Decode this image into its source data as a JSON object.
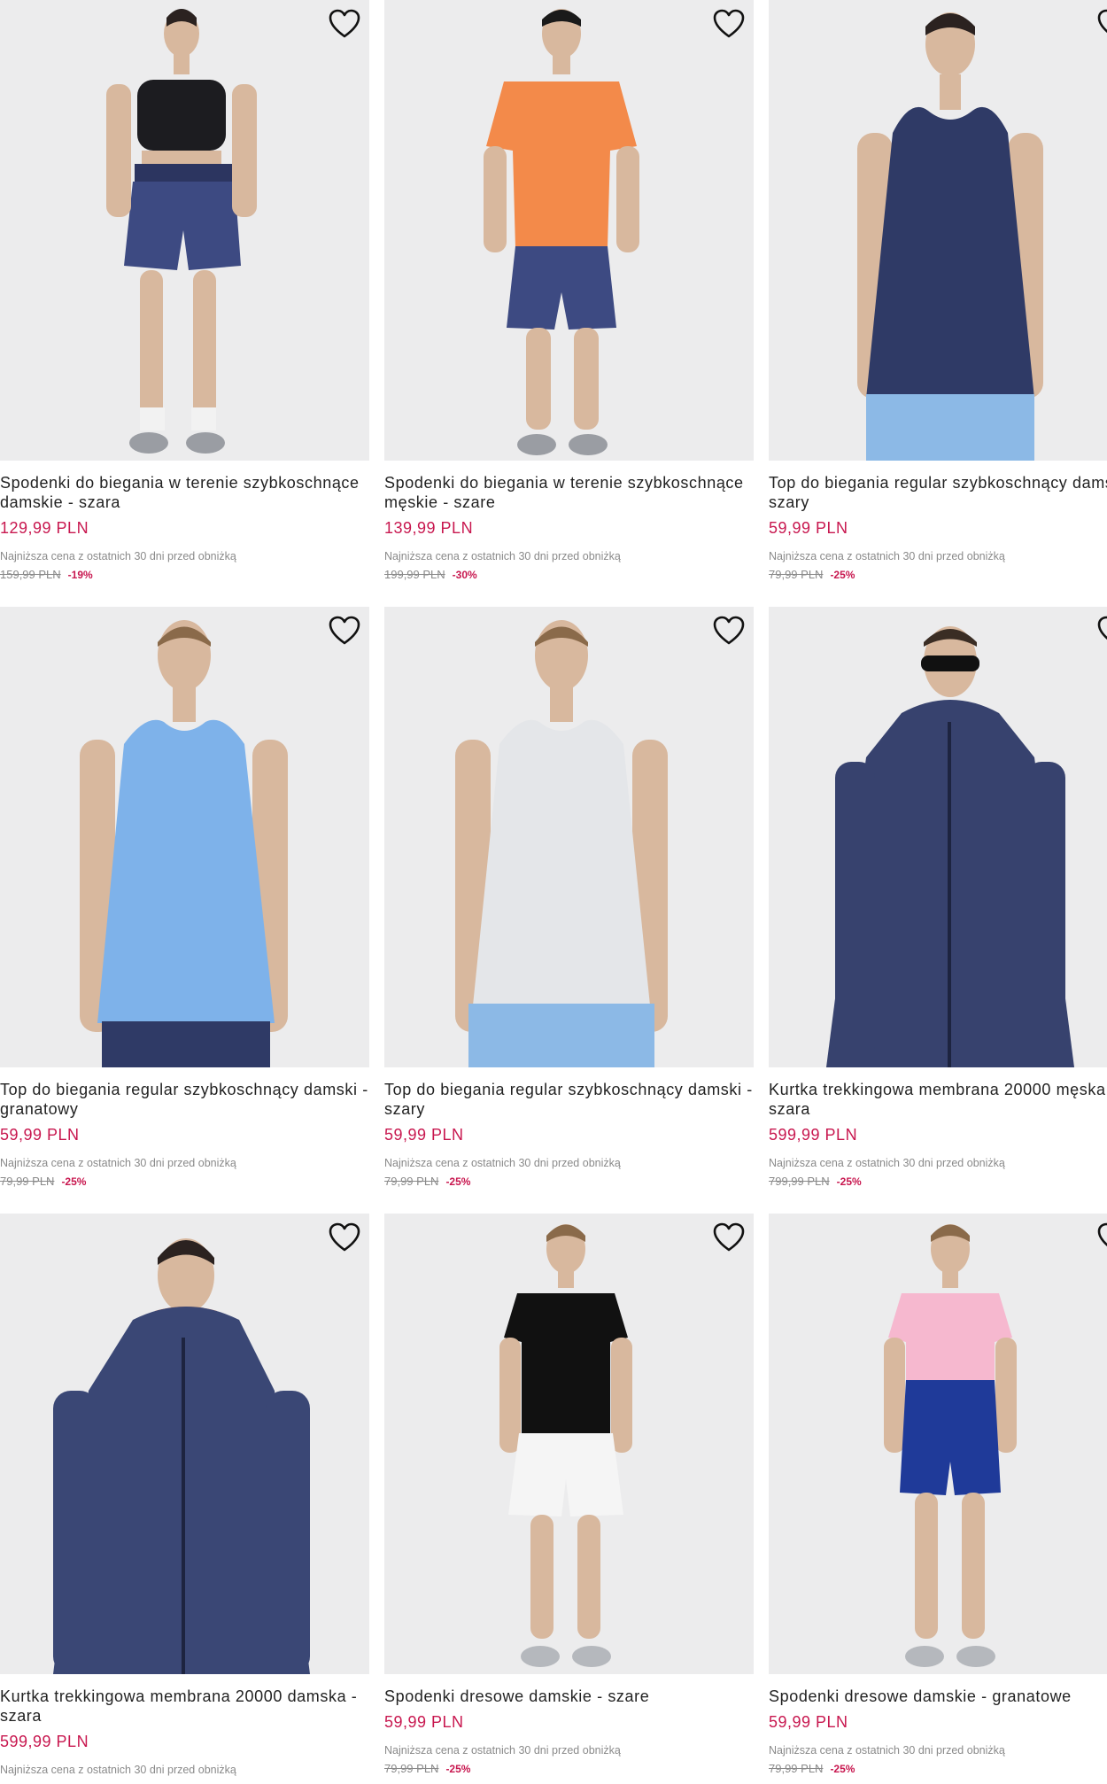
{
  "products": [
    {
      "name": "Spodenki do biegania w terenie szybkoschnące damskie - szara",
      "price": "129,99 PLN",
      "lowest_label": "Najniższa cena z ostatnich 30 dni przed obniżką",
      "old_price": "159,99 PLN",
      "discount": "-19%",
      "favorite_icon": "heart-icon"
    },
    {
      "name": "Spodenki do biegania w terenie szybkoschnące męskie - szare",
      "price": "139,99 PLN",
      "lowest_label": "Najniższa cena z ostatnich 30 dni przed obniżką",
      "old_price": "199,99 PLN",
      "discount": "-30%",
      "favorite_icon": "heart-icon"
    },
    {
      "name": "Top do biegania regular szybkoschnący damskie - szary",
      "price": "59,99 PLN",
      "lowest_label": "Najniższa cena z ostatnich 30 dni przed obniżką",
      "old_price": "79,99 PLN",
      "discount": "-25%",
      "favorite_icon": "heart-icon"
    },
    {
      "name": "Top do biegania regular szybkoschnący damski - granatowy",
      "price": "59,99 PLN",
      "lowest_label": "Najniższa cena z ostatnich 30 dni przed obniżką",
      "old_price": "79,99 PLN",
      "discount": "-25%",
      "favorite_icon": "heart-icon"
    },
    {
      "name": "Top do biegania regular szybkoschnący damski - szary",
      "price": "59,99 PLN",
      "lowest_label": "Najniższa cena z ostatnich 30 dni przed obniżką",
      "old_price": "79,99 PLN",
      "discount": "-25%",
      "favorite_icon": "heart-icon"
    },
    {
      "name": "Kurtka trekkingowa membrana 20000 męska - szara",
      "price": "599,99 PLN",
      "lowest_label": "Najniższa cena z ostatnich 30 dni przed obniżką",
      "old_price": "799,99 PLN",
      "discount": "-25%",
      "favorite_icon": "heart-icon"
    },
    {
      "name": "Kurtka trekkingowa membrana 20000 damska - szara",
      "price": "599,99 PLN",
      "lowest_label": "Najniższa cena z ostatnich 30 dni przed obniżką",
      "old_price": "",
      "discount": "",
      "favorite_icon": "heart-icon"
    },
    {
      "name": "Spodenki dresowe damskie - szare",
      "price": "59,99 PLN",
      "lowest_label": "Najniższa cena z ostatnich 30 dni przed obniżką",
      "old_price": "79,99 PLN",
      "discount": "-25%",
      "favorite_icon": "heart-icon"
    },
    {
      "name": "Spodenki dresowe damskie - granatowe",
      "price": "59,99 PLN",
      "lowest_label": "Najniższa cena z ostatnich 30 dni przed obniżką",
      "old_price": "79,99 PLN",
      "discount": "-25%",
      "favorite_icon": "heart-icon"
    }
  ],
  "colors": {
    "price": "#c8174f",
    "image_bg": "#ececed",
    "text": "#222222",
    "muted": "#8a8a8a"
  }
}
